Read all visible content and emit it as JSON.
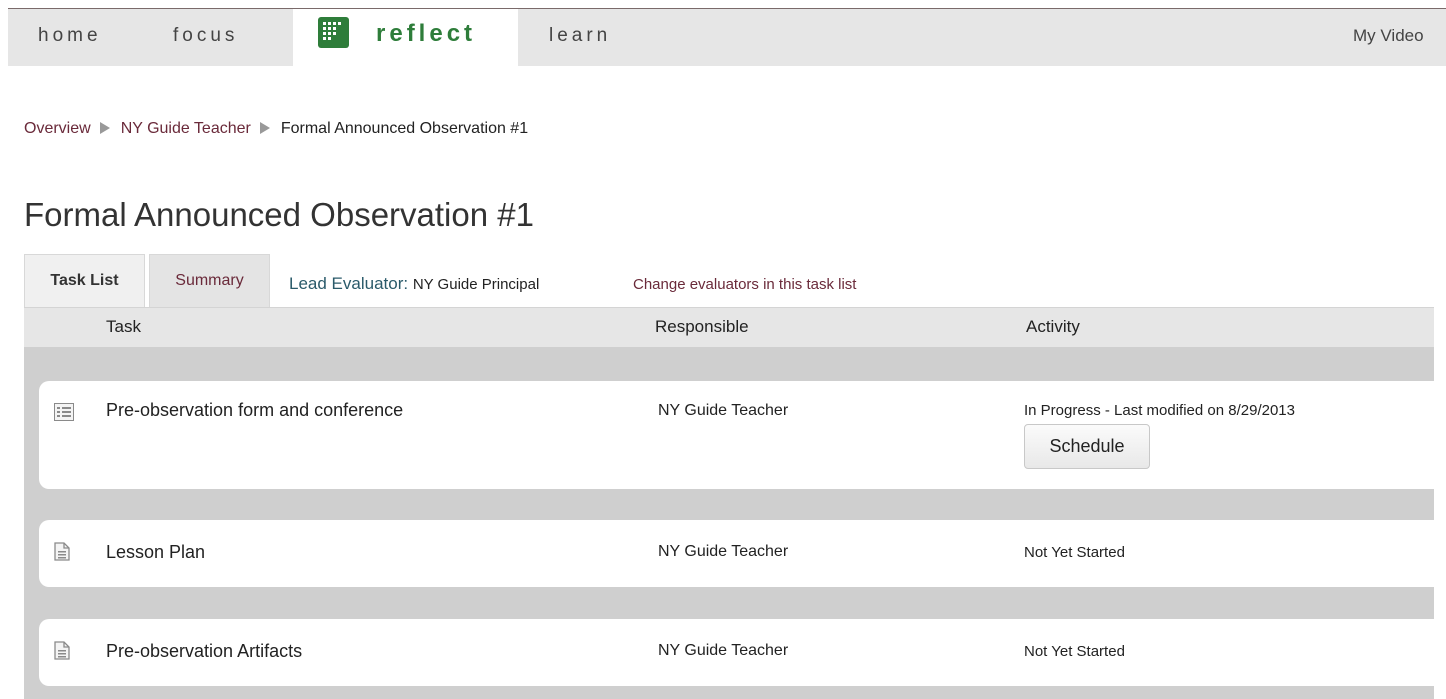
{
  "nav": {
    "home": "home",
    "focus": "focus",
    "reflect": "reflect",
    "learn": "learn",
    "my_videos": "My Video"
  },
  "breadcrumb": [
    "Overview",
    "NY Guide Teacher",
    "Formal Announced Observation #1"
  ],
  "page_title": "Formal Announced Observation #1",
  "tabs": {
    "task_list": "Task List",
    "summary": "Summary"
  },
  "lead_evaluator": {
    "label": "Lead Evaluator:",
    "value": "NY Guide Principal",
    "change_link": "Change evaluators in this task list"
  },
  "table": {
    "headers": {
      "task": "Task",
      "responsible": "Responsible",
      "activity": "Activity"
    },
    "rows": [
      {
        "icon": "form-list-icon",
        "task": "Pre-observation form and conference",
        "responsible": "NY Guide Teacher",
        "activity": "In Progress - Last modified on 8/29/2013",
        "button": "Schedule"
      },
      {
        "icon": "document-icon",
        "task": "Lesson Plan",
        "responsible": "NY Guide Teacher",
        "activity": "Not Yet Started"
      },
      {
        "icon": "document-icon",
        "task": "Pre-observation Artifacts",
        "responsible": "NY Guide Teacher",
        "activity": "Not Yet Started"
      }
    ]
  },
  "colors": {
    "brand_green": "#2e7d3a",
    "link_maroon": "#6a2a3a",
    "nav_bg": "#e6e6e6",
    "table_bg": "#cfcfcf"
  }
}
